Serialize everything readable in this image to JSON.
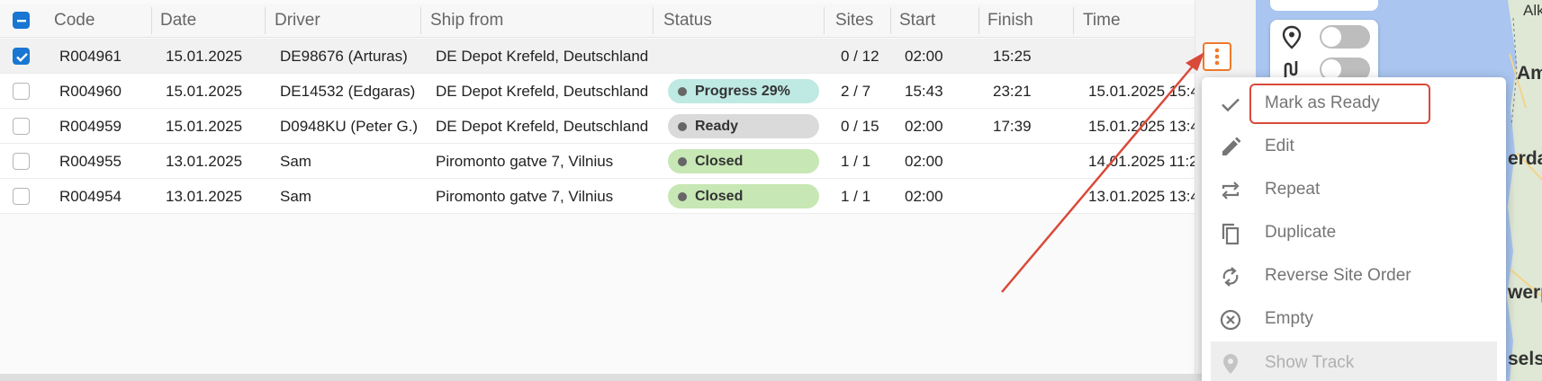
{
  "table": {
    "columns": [
      "Code",
      "Date",
      "Driver",
      "Ship from",
      "Status",
      "Sites",
      "Start",
      "Finish",
      "Time"
    ],
    "rows": [
      {
        "code": "R004961",
        "date": "15.01.2025",
        "driver": "DE98676 (Arturas)",
        "ship_from": "DE Depot Krefeld, Deutschland",
        "status": "",
        "sites": "0 / 12",
        "start": "02:00",
        "finish": "15:25",
        "time": "",
        "checked": true
      },
      {
        "code": "R004960",
        "date": "15.01.2025",
        "driver": "DE14532 (Edgaras)",
        "ship_from": "DE Depot Krefeld, Deutschland",
        "status": "Progress 29%",
        "sites": "2 / 7",
        "start": "15:43",
        "finish": "23:21",
        "time": "15.01.2025 15:4",
        "checked": false
      },
      {
        "code": "R004959",
        "date": "15.01.2025",
        "driver": "D0948KU (Peter G.)",
        "ship_from": "DE Depot Krefeld, Deutschland",
        "status": "Ready",
        "sites": "0 / 15",
        "start": "02:00",
        "finish": "17:39",
        "time": "15.01.2025 13:4",
        "checked": false
      },
      {
        "code": "R004955",
        "date": "13.01.2025",
        "driver": "Sam",
        "ship_from": "Piromonto gatve 7, Vilnius",
        "status": "Closed",
        "sites": "1 / 1",
        "start": "02:00",
        "finish": "",
        "time": "14.01.2025 11:2",
        "checked": false
      },
      {
        "code": "R004954",
        "date": "13.01.2025",
        "driver": "Sam",
        "ship_from": "Piromonto gatve 7, Vilnius",
        "status": "Closed",
        "sites": "1 / 1",
        "start": "02:00",
        "finish": "",
        "time": "13.01.2025 13:4",
        "checked": false
      }
    ],
    "status_colors": {
      "Progress 29%": "#bfe9e3",
      "Ready": "#dadada",
      "Closed": "#c7e7b4"
    }
  },
  "context_menu": {
    "items": [
      {
        "label": "Mark as Ready",
        "icon": "check-icon",
        "disabled": false
      },
      {
        "label": "Edit",
        "icon": "pencil-icon",
        "disabled": false
      },
      {
        "label": "Repeat",
        "icon": "repeat-icon",
        "disabled": false
      },
      {
        "label": "Duplicate",
        "icon": "duplicate-icon",
        "disabled": false
      },
      {
        "label": "Reverse Site Order",
        "icon": "reverse-icon",
        "disabled": false
      },
      {
        "label": "Empty",
        "icon": "clear-circle-icon",
        "disabled": false
      },
      {
        "label": "Show Track",
        "icon": "location-pin-icon",
        "disabled": true
      }
    ]
  },
  "map": {
    "labels": [
      "Alk",
      "Am",
      "erda",
      "werp",
      "sels"
    ],
    "water_color": "#a9c5f0",
    "land_color": "#dfe8d5"
  },
  "colors": {
    "accent": "#1976d2",
    "row_menu_border": "#ee7a2b",
    "annotation_red": "#d94a3a"
  }
}
